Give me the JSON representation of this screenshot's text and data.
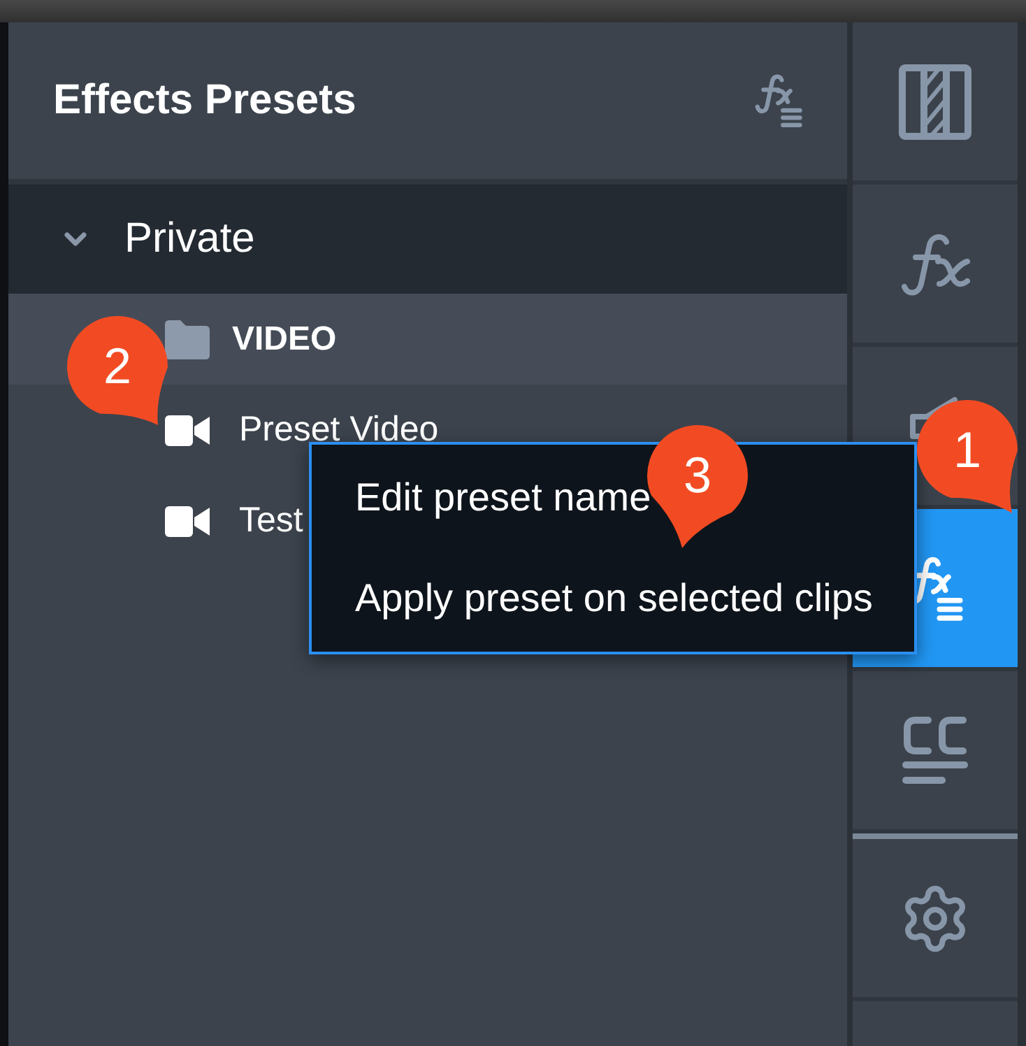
{
  "panel": {
    "title": "Effects Presets"
  },
  "tree": [
    {
      "label": "Private",
      "kind": "group",
      "expanded": true,
      "children": [
        {
          "label": "VIDEO",
          "kind": "folder",
          "selected": true,
          "children": [
            {
              "label": "Preset Video",
              "kind": "preset",
              "selected": false
            },
            {
              "label": "Test",
              "kind": "preset",
              "selected": false
            }
          ]
        }
      ]
    }
  ],
  "side_tabs": [
    {
      "kind": "panels",
      "selected": false
    },
    {
      "kind": "effects",
      "selected": false
    },
    {
      "kind": "audio",
      "selected": false
    },
    {
      "kind": "presets",
      "selected": true
    },
    {
      "kind": "captions",
      "selected": false
    }
  ],
  "footer_tabs": [
    {
      "kind": "settings",
      "selected": false
    }
  ],
  "context_menu": {
    "items": [
      {
        "label": "Edit preset name"
      },
      {
        "label": "Apply preset on selected clips"
      }
    ]
  },
  "callouts": [
    {
      "number": "1"
    },
    {
      "number": "2"
    },
    {
      "number": "3"
    }
  ]
}
